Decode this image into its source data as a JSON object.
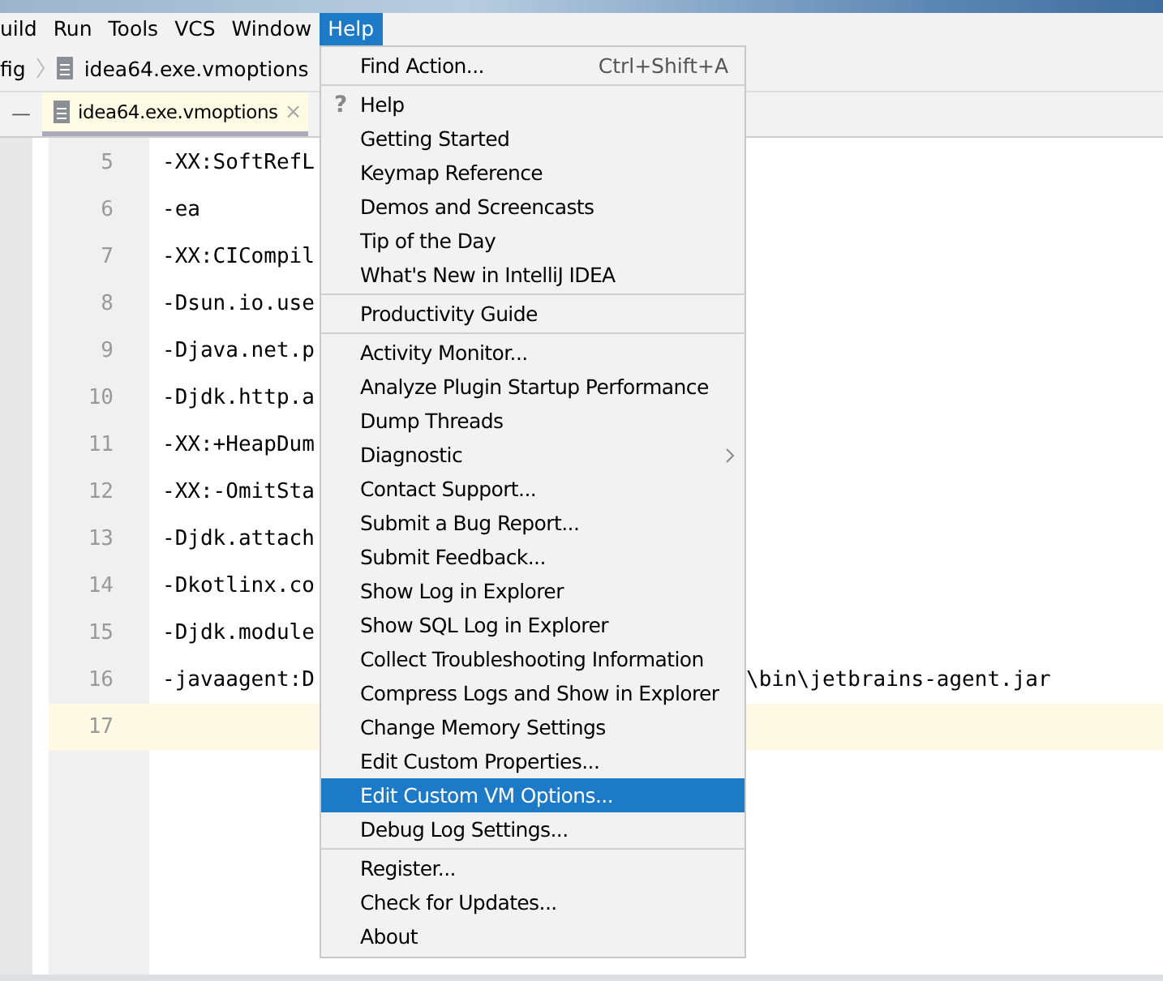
{
  "menu_bar": [
    {
      "label": "uild",
      "selected": false
    },
    {
      "label": "Run",
      "selected": false
    },
    {
      "label": "Tools",
      "selected": false
    },
    {
      "label": "VCS",
      "selected": false
    },
    {
      "label": "Window",
      "selected": false
    },
    {
      "label": "Help",
      "selected": true
    }
  ],
  "breadcrumb": {
    "parent": "fig",
    "file": "idea64.exe.vmoptions"
  },
  "tab_bar": {
    "collapse": "—",
    "tabs": [
      {
        "label": "idea64.exe.vmoptions",
        "close": "×",
        "selected": true
      }
    ]
  },
  "editor": {
    "lines": [
      {
        "number": "5",
        "text": "-XX:SoftRefL",
        "current": false
      },
      {
        "number": "6",
        "text": "-ea",
        "current": false
      },
      {
        "number": "7",
        "text": "-XX:CICompil",
        "current": false
      },
      {
        "number": "8",
        "text": "-Dsun.io.use",
        "current": false
      },
      {
        "number": "9",
        "text": "-Djava.net.p",
        "current": false
      },
      {
        "number": "10",
        "text": "-Djdk.http.a",
        "current": false
      },
      {
        "number": "11",
        "text": "-XX:+HeapDum",
        "current": false
      },
      {
        "number": "12",
        "text": "-XX:-OmitSta",
        "current": false
      },
      {
        "number": "13",
        "text": "-Djdk.attach",
        "current": false
      },
      {
        "number": "14",
        "text": "-Dkotlinx.co",
        "current": false
      },
      {
        "number": "15",
        "text": "-Djdk.module",
        "current": false
      },
      {
        "number": "16",
        "text": "-javaagent:D",
        "text_after": "\\bin\\jetbrains-agent.jar",
        "current": false
      },
      {
        "number": "17",
        "current": true
      }
    ]
  },
  "help_menu": {
    "groups": [
      [
        {
          "label": "Find Action...",
          "shortcut": "Ctrl+Shift+A",
          "selected": false
        }
      ],
      [
        {
          "label": "Help",
          "icon": "?",
          "selected": false
        },
        {
          "label": "Getting Started",
          "selected": false
        },
        {
          "label": "Keymap Reference",
          "selected": false
        },
        {
          "label": "Demos and Screencasts",
          "selected": false
        },
        {
          "label": "Tip of the Day",
          "selected": false
        },
        {
          "label": "What's New in IntelliJ IDEA",
          "selected": false
        }
      ],
      [
        {
          "label": "Productivity Guide",
          "selected": false
        }
      ],
      [
        {
          "label": "Activity Monitor...",
          "selected": false
        },
        {
          "label": "Analyze Plugin Startup Performance",
          "selected": false
        },
        {
          "label": "Dump Threads",
          "selected": false
        },
        {
          "label": "Diagnostic",
          "submenu": true,
          "selected": false
        },
        {
          "label": "Contact Support...",
          "selected": false
        },
        {
          "label": "Submit a Bug Report...",
          "selected": false
        },
        {
          "label": "Submit Feedback...",
          "selected": false
        },
        {
          "label": "Show Log in Explorer",
          "selected": false
        },
        {
          "label": "Show SQL Log in Explorer",
          "selected": false
        },
        {
          "label": "Collect Troubleshooting Information",
          "selected": false
        },
        {
          "label": "Compress Logs and Show in Explorer",
          "selected": false
        },
        {
          "label": "Change Memory Settings",
          "selected": false
        },
        {
          "label": "Edit Custom Properties...",
          "selected": false
        },
        {
          "label": "Edit Custom VM Options...",
          "selected": true
        },
        {
          "label": "Debug Log Settings...",
          "selected": false
        }
      ],
      [
        {
          "label": "Register...",
          "selected": false
        },
        {
          "label": "Check for Updates...",
          "selected": false
        },
        {
          "label": "About",
          "selected": false
        }
      ]
    ]
  }
}
